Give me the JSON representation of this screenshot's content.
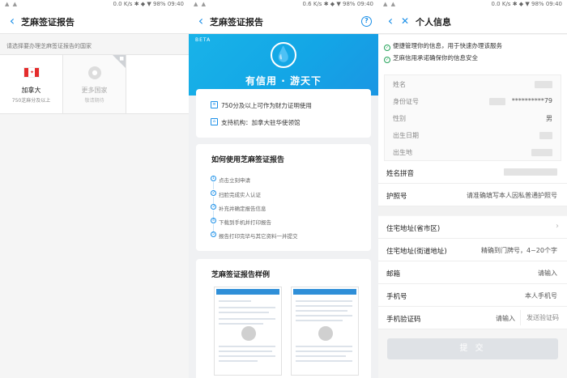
{
  "status": {
    "net": "0.0 K/s",
    "net2": "0.6 K/s",
    "battery": "98%",
    "time": "09:40"
  },
  "panel1": {
    "title": "芝麻签证报告",
    "prompt": "请选择要办理芝麻签证报告的国家",
    "countries": [
      {
        "name": "加拿大",
        "sub": "750芝麻分及以上"
      },
      {
        "name": "更多国家",
        "sub": "敬请期待"
      }
    ]
  },
  "panel2": {
    "title": "芝麻签证报告",
    "help": "?",
    "beta": "BETA",
    "slogan": "有信用 · 游天下",
    "features": [
      "750分及以上可作为财力证明使用",
      "支持机构：加拿大驻华使领馆"
    ],
    "how_title": "如何使用芝麻签证报告",
    "steps": [
      "点击立刻申请",
      "扫脸完成实人认证",
      "补充并确定报告信息",
      "下载到手机并打印报告",
      "报告打印完毕与其它资料一并提交"
    ],
    "sample_title": "芝麻签证报告样例"
  },
  "panel3": {
    "title": "个人信息",
    "assurances": [
      "便捷管理你的信息，用于快速办理该服务",
      "芝麻信用承诺确保你的信息安全"
    ],
    "info": [
      {
        "label": "姓名",
        "value": ""
      },
      {
        "label": "身份证号",
        "value": "**********79"
      },
      {
        "label": "性别",
        "value": "男"
      },
      {
        "label": "出生日期",
        "value": ""
      },
      {
        "label": "出生地",
        "value": ""
      }
    ],
    "fields": [
      {
        "label": "姓名拼音",
        "placeholder": ""
      },
      {
        "label": "护照号",
        "placeholder": "请准确填写本人因私普通护照号"
      },
      {
        "label": "住宅地址(省市区)",
        "placeholder": ""
      },
      {
        "label": "住宅地址(街道地址)",
        "placeholder": "精确到门牌号，4~20个字"
      },
      {
        "label": "邮箱",
        "placeholder": "请输入"
      },
      {
        "label": "手机号",
        "placeholder": "本人手机号"
      },
      {
        "label": "手机验证码",
        "placeholder": "请输入"
      }
    ],
    "send_code": "发送验证码",
    "submit": "提 交"
  },
  "colors": {
    "accent": "#1a8fe8",
    "hero": "#19b3e8",
    "success": "#25a35a"
  }
}
